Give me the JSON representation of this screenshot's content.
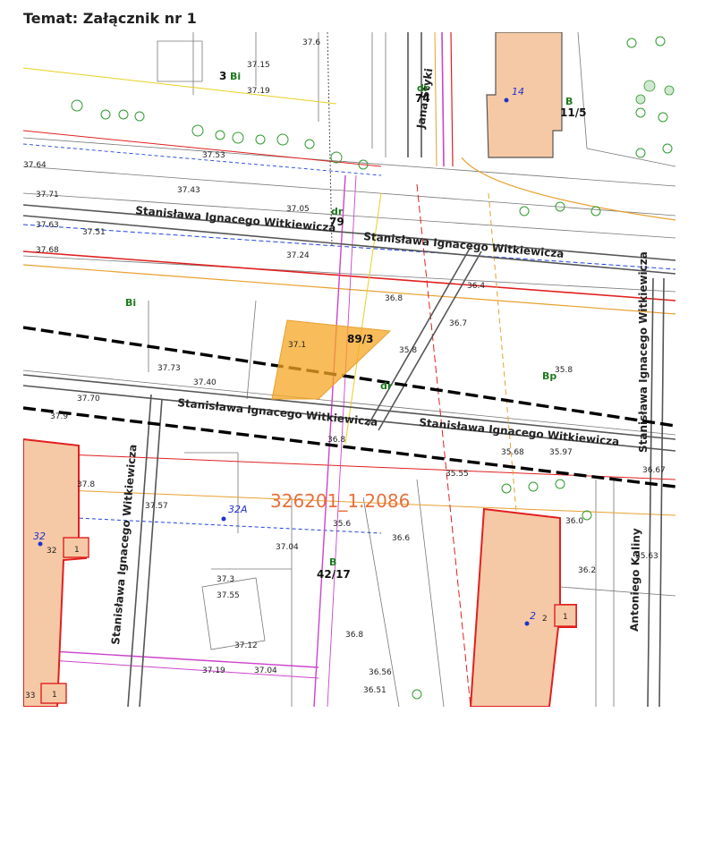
{
  "title": "Temat: Załącznik nr 1",
  "colors": {
    "highlight_fill": "#f5a623",
    "building_fill": "#f6c9a6",
    "building_stroke": "#e02020",
    "street_line": "#555555",
    "boundary_dash": "#000000",
    "utility_red": "#e02020",
    "utility_orange": "#e8a030",
    "utility_magenta": "#cc44cc",
    "utility_blue": "#2244dd",
    "utility_yellow": "#e8d020",
    "label_green": "#1f7a1f",
    "label_blue": "#2233cc",
    "sheet_label": "#e8703a"
  },
  "map": {
    "streets": [
      {
        "id": "witkiewicza-upper-left",
        "name": "Stanisława Ignacego Witkiewicza"
      },
      {
        "id": "witkiewicza-upper-right",
        "name": "Stanisława Ignacego Witkiewicza"
      },
      {
        "id": "witkiewicza-lower-left",
        "name": "Stanisława Ignacego Witkiewicza"
      },
      {
        "id": "witkiewicza-lower-right",
        "name": "Stanisława Ignacego Witkiewicza"
      },
      {
        "id": "witkiewicza-vertical-left",
        "name": "Stanisława Ignacego Witkiewicza"
      },
      {
        "id": "witkiewicza-vertical-right",
        "name": "Stanisława Ignacego Witkiewicza"
      },
      {
        "id": "styki",
        "name": "Jana Styki"
      },
      {
        "id": "kaliny",
        "name": "Antoniego Kaliny"
      }
    ],
    "parcels": [
      {
        "id": "p89-3",
        "number": "89/3"
      },
      {
        "id": "p79",
        "number": "79"
      },
      {
        "id": "p74",
        "number": "74"
      },
      {
        "id": "p11-5",
        "number": "11/5"
      },
      {
        "id": "p42-17",
        "number": "42/17"
      },
      {
        "id": "p3",
        "number": "3"
      }
    ],
    "land_use": [
      {
        "id": "lu-3bi",
        "code": "Bi"
      },
      {
        "id": "lu-dr-top",
        "code": "dr"
      },
      {
        "id": "lu-b-top",
        "code": "B"
      },
      {
        "id": "lu-dr-mid",
        "code": "dr"
      },
      {
        "id": "lu-bi-left",
        "code": "Bi"
      },
      {
        "id": "lu-bp",
        "code": "Bp"
      },
      {
        "id": "lu-dr-low",
        "code": "dr"
      },
      {
        "id": "lu-b-low",
        "code": "B"
      }
    ],
    "addresses": [
      {
        "id": "a14",
        "number": "14"
      },
      {
        "id": "a32a",
        "number": "32A"
      },
      {
        "id": "a32",
        "number": "32"
      },
      {
        "id": "a2",
        "number": "2"
      }
    ],
    "building_tags": [
      {
        "id": "bt-32",
        "number": "32"
      },
      {
        "id": "bt-1a",
        "number": "1"
      },
      {
        "id": "bt-33",
        "number": "33"
      },
      {
        "id": "bt-1b",
        "number": "1"
      },
      {
        "id": "bt-2",
        "number": "2"
      },
      {
        "id": "bt-1c",
        "number": "1"
      }
    ],
    "sheet_label": "326201_1.2086",
    "elevations": [
      "37.6",
      "37.15",
      "37.19",
      "37.53",
      "37.64",
      "37.71",
      "37.63",
      "37.51",
      "37.68",
      "37.05",
      "37.24",
      "37.43",
      "37.1",
      "37.73",
      "37.40",
      "37.70",
      "37.9",
      "36.8",
      "37.8",
      "37.57",
      "37.04",
      "37.3",
      "37.55",
      "37.12",
      "37.19",
      "37.04",
      "35.8",
      "36.8",
      "36.56",
      "36.51",
      "35.6",
      "36.2",
      "36.0",
      "35.97",
      "35.68",
      "36.67",
      "36.6",
      "35.55",
      "35.63",
      "36.7",
      "36.4",
      "35.8",
      "36.8"
    ]
  }
}
